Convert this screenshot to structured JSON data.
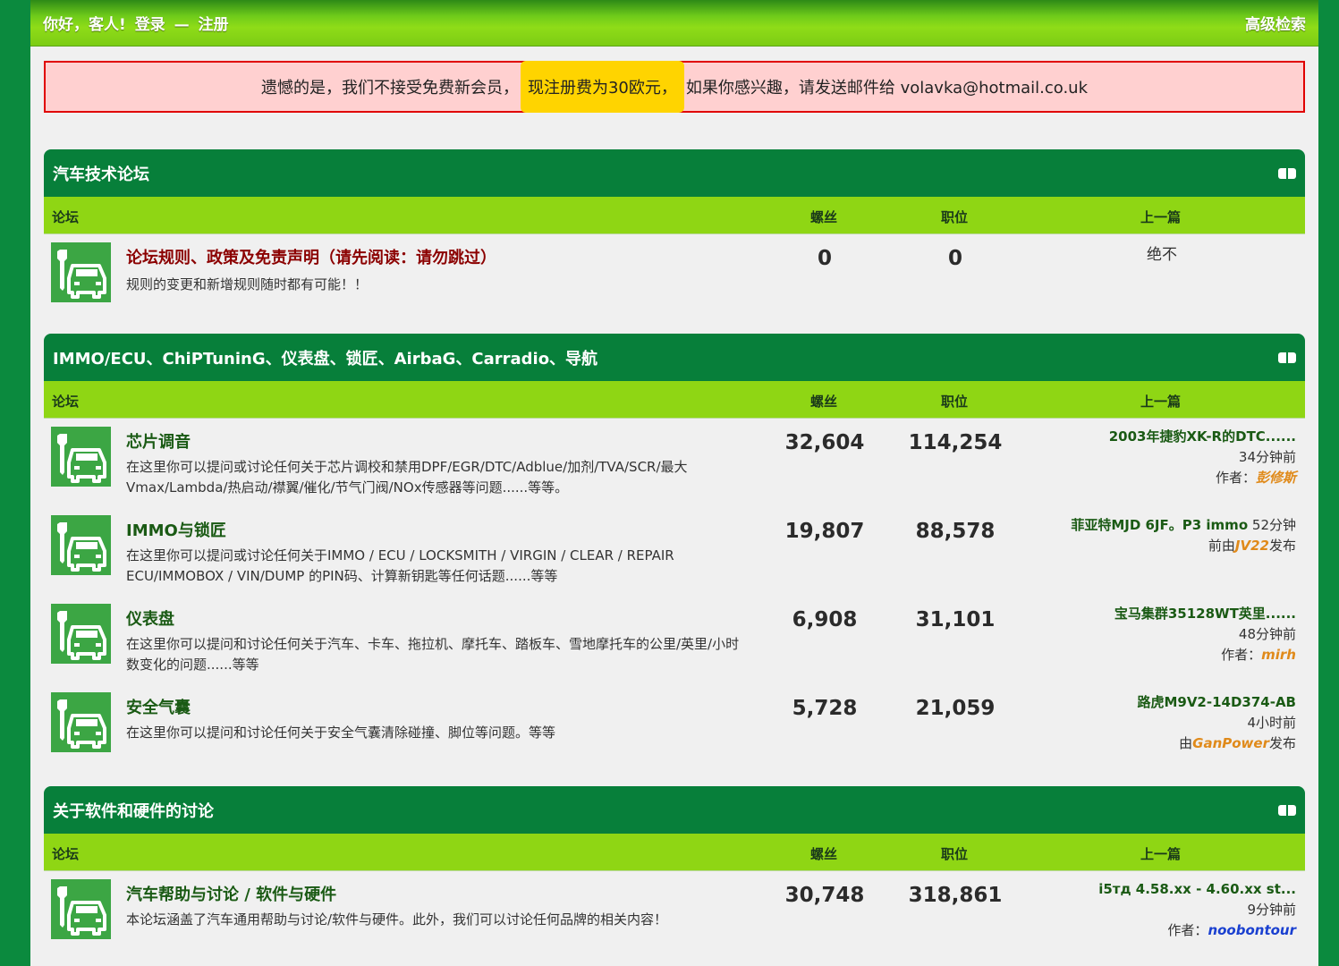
{
  "topbar": {
    "greeting": "你好，客人!",
    "login": "登录",
    "dash": "—",
    "register": "注册",
    "advanced_search": "高级检索"
  },
  "notice": {
    "before": "遗憾的是，我们不接受免费新会员，",
    "highlight": "现注册费为30欧元，",
    "after": "如果你感兴趣，请发送邮件给 volavka@hotmail.co.uk"
  },
  "columns": {
    "forum": "论坛",
    "threads": "螺丝",
    "posts": "职位",
    "last_post": "上一篇"
  },
  "categories": [
    {
      "title": "汽车技术论坛",
      "forums": [
        {
          "name": "论坛规则、政策及免责声明（请先阅读：请勿跳过）",
          "desc": "规则的变更和新增规则随时都有可能！！",
          "threads": "0",
          "posts": "0",
          "last_line1": "绝不"
        }
      ]
    },
    {
      "title": "IMMO/ECU、ChiPTuninG、仪表盘、锁匠、AirbaG、Carradio、导航",
      "forums": [
        {
          "name": "芯片调音",
          "desc": "在这里你可以提问或讨论任何关于芯片调校和禁用DPF/EGR/DTC/Adblue/加剂/TVA/SCR/最大Vmax/Lambda/热启动/襟翼/催化/节气门阀/NOx传感器等问题......等等。",
          "threads": "32,604",
          "posts": "114,254",
          "last_title": "2003年捷豹XK-R的DTC......",
          "last_time": "34分钟前",
          "last_by_label": "作者：",
          "last_user": "彭修斯"
        },
        {
          "name": "IMMO与锁匠",
          "desc": "在这里你可以提问或讨论任何关于IMMO / ECU / LOCKSMITH / VIRGIN / CLEAR / REPAIR ECU/IMMOBOX / VIN/DUMP 的PIN码、计算新钥匙等任何话题......等等",
          "threads": "19,807",
          "posts": "88,578",
          "last_title": "菲亚特MJD 6JF。P3 immo",
          "last_time": "52分钟",
          "last_prefix": "前由",
          "last_user": "JV22",
          "last_suffix": "发布"
        },
        {
          "name": "仪表盘",
          "desc": "在这里你可以提问和讨论任何关于汽车、卡车、拖拉机、摩托车、踏板车、雪地摩托车的公里/英里/小时数变化的问题......等等",
          "threads": "6,908",
          "posts": "31,101",
          "last_title": "宝马集群35128WT英里......",
          "last_time": "48分钟前",
          "last_by_label": "作者：",
          "last_user": "mirh"
        },
        {
          "name": "安全气囊",
          "desc": "在这里你可以提问和讨论任何关于安全气囊清除碰撞、脚位等问题。等等",
          "threads": "5,728",
          "posts": "21,059",
          "last_title": "路虎M9V2-14D374-AB",
          "last_time": "4小时前",
          "last_prefix": "由",
          "last_user": "GanPower",
          "last_suffix": "发布"
        }
      ]
    },
    {
      "title": "关于软件和硬件的讨论",
      "forums": [
        {
          "name": "汽车帮助与讨论 / 软件与硬件",
          "desc": "本论坛涵盖了汽车通用帮助与讨论/软件与硬件。此外，我们可以讨论任何品牌的相关内容！",
          "threads": "30,748",
          "posts": "318,861",
          "last_title": "i5тд 4.58.xx - 4.60.xx st...",
          "last_time": "9分钟前",
          "last_by_label": "作者：",
          "last_user": "noobontour"
        }
      ]
    }
  ],
  "colors": {
    "outer_bg": "#0b8a3e",
    "category_header": "#077f3a",
    "column_header": "#8fd614",
    "notice_bg": "#ffd0d0",
    "notice_border": "#e00000",
    "highlight": "#ffd400",
    "username_orange": "#e08a1a",
    "username_blue": "#1a40d0"
  },
  "icons": {
    "forum_icon": "car-wrench-icon",
    "collapse_icon": "collapse-toggle-icon"
  }
}
